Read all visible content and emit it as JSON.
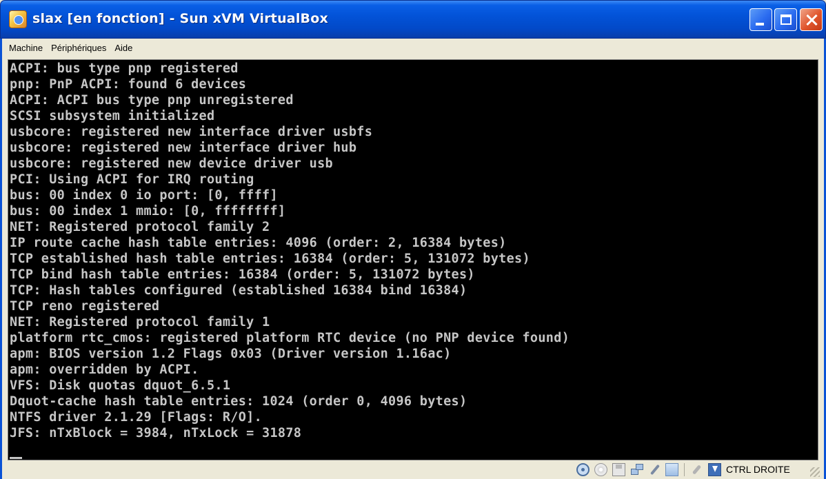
{
  "window": {
    "title": "slax [en fonction] - Sun xVM VirtualBox",
    "icon": "virtualbox-app-icon",
    "controls": [
      "minimize-icon",
      "maximize-icon",
      "close-icon"
    ]
  },
  "menu": {
    "items": [
      "Machine",
      "Périphériques",
      "Aide"
    ]
  },
  "console": {
    "lines": [
      "ACPI: bus type pnp registered",
      "pnp: PnP ACPI: found 6 devices",
      "ACPI: ACPI bus type pnp unregistered",
      "SCSI subsystem initialized",
      "usbcore: registered new interface driver usbfs",
      "usbcore: registered new interface driver hub",
      "usbcore: registered new device driver usb",
      "PCI: Using ACPI for IRQ routing",
      "bus: 00 index 0 io port: [0, ffff]",
      "bus: 00 index 1 mmio: [0, ffffffff]",
      "NET: Registered protocol family 2",
      "IP route cache hash table entries: 4096 (order: 2, 16384 bytes)",
      "TCP established hash table entries: 16384 (order: 5, 131072 bytes)",
      "TCP bind hash table entries: 16384 (order: 5, 131072 bytes)",
      "TCP: Hash tables configured (established 16384 bind 16384)",
      "TCP reno registered",
      "NET: Registered protocol family 1",
      "platform rtc_cmos: registered platform RTC device (no PNP device found)",
      "apm: BIOS version 1.2 Flags 0x03 (Driver version 1.16ac)",
      "apm: overridden by ACPI.",
      "VFS: Disk quotas dquot_6.5.1",
      "Dquot-cache hash table entries: 1024 (order 0, 4096 bytes)",
      "NTFS driver 2.1.29 [Flags: R/O].",
      "JFS: nTxBlock = 3984, nTxLock = 31878"
    ],
    "text_color": "#c6c6c6",
    "background": "#000000"
  },
  "statusbar": {
    "icons": [
      "hard-disk-icon",
      "cd-dvd-icon",
      "floppy-icon",
      "network-icon",
      "usb-icon",
      "shared-folders-icon",
      "mouse-integration-icon",
      "keyboard-capture-icon"
    ],
    "host_key": "CTRL DROITE"
  }
}
